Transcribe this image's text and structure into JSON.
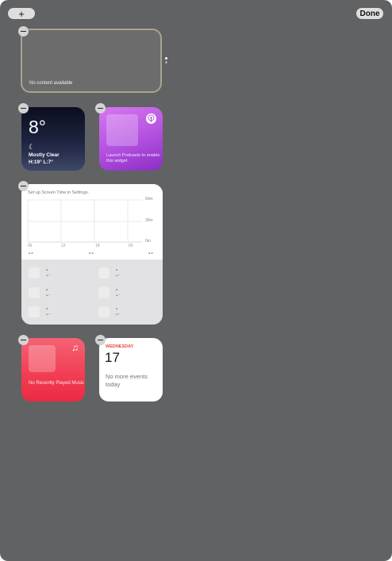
{
  "toolbar": {
    "add_label": "+",
    "done_label": "Done"
  },
  "placeholder_widget": {
    "text": "No content available"
  },
  "weather": {
    "temperature": "8°",
    "condition_icon": "moon-icon",
    "condition": "Mostly Clear",
    "high_low": "H:19° L:7°"
  },
  "podcasts": {
    "icon": "podcasts-icon",
    "message": "Launch Podcasts to enable this widget"
  },
  "screen_time": {
    "title": "Set up Screen Time in Settings.",
    "y_ticks": [
      "60m",
      "30m",
      "0m"
    ],
    "x_ticks": [
      "06",
      "12",
      "18",
      "00"
    ],
    "summary": [
      "--",
      "--",
      "--"
    ],
    "apps": [
      {
        "value": "--"
      },
      {
        "value": "--"
      },
      {
        "value": "--"
      },
      {
        "value": "--"
      },
      {
        "value": "--"
      },
      {
        "value": "--"
      }
    ]
  },
  "music": {
    "icon": "music-note-icon",
    "message": "No Recently Played Music"
  },
  "calendar": {
    "weekday": "WEDNESDAY",
    "date": "17",
    "message": "No more events today"
  },
  "colors": {
    "background": "#616263",
    "calendar_accent": "#e6493b",
    "music_red": "#f23f54",
    "podcasts_purple": "#b250e0",
    "weather_navy": "#1e2440"
  }
}
